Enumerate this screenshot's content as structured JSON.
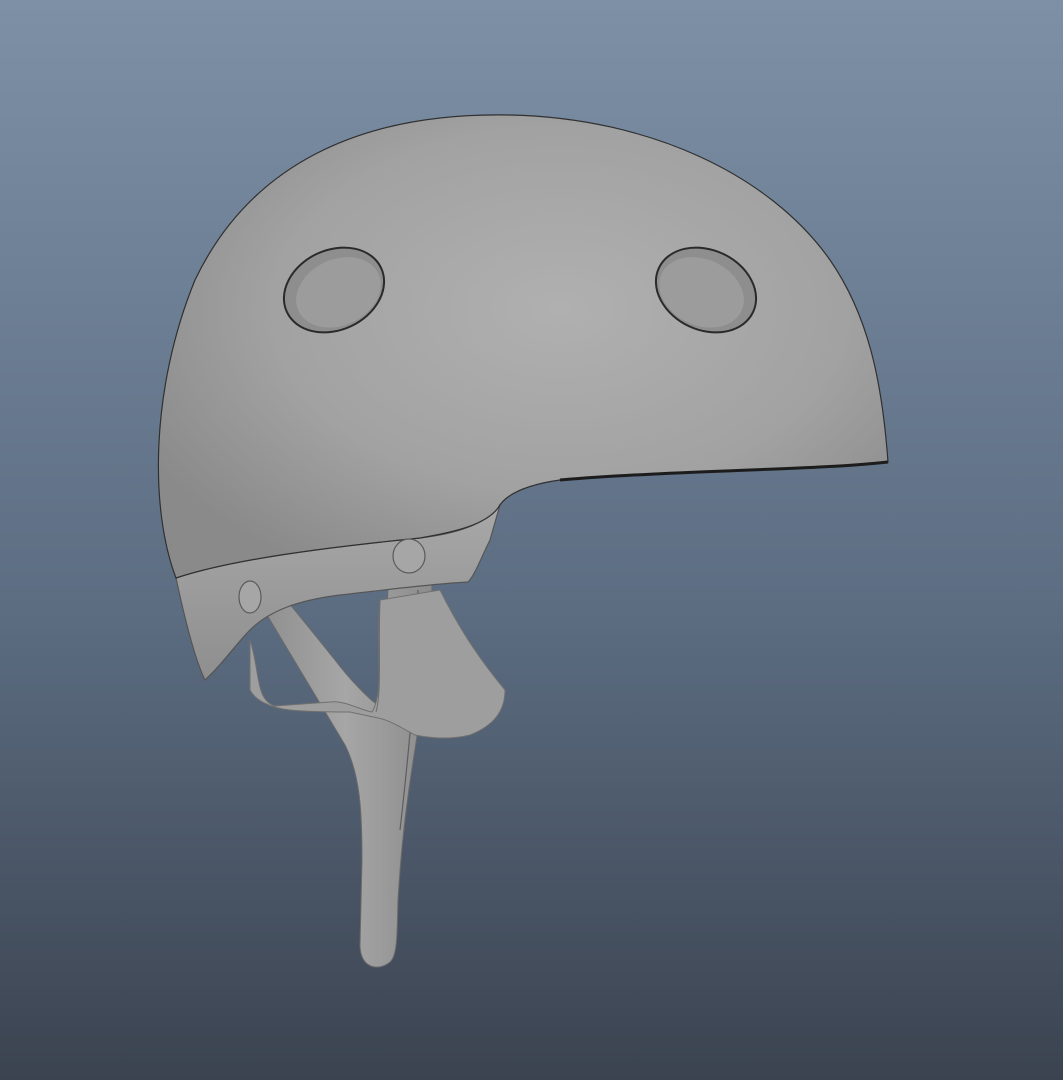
{
  "viewport": {
    "panel": "3d-model-viewport",
    "background_gradient": [
      "#7d90a6",
      "#5d6e83",
      "#3b4350"
    ],
    "model": {
      "subject": "helmet",
      "shading": "smooth-gray",
      "shell_color": "#a4a4a4",
      "strap_color": "#9c9c9c",
      "edge_color": "#1c1c1c"
    }
  }
}
